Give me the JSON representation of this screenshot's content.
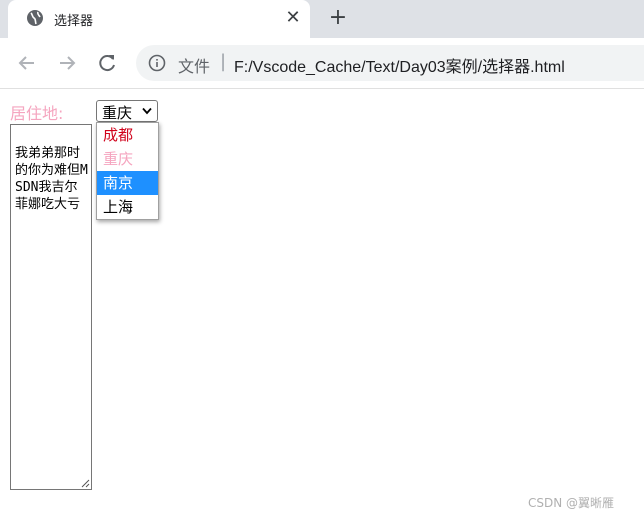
{
  "browser": {
    "tab": {
      "title": "选择器",
      "close_glyph": "✕"
    },
    "newtab_glyph": "+",
    "omnibox": {
      "scheme_label": "文件",
      "separator": "|",
      "url": "F:/Vscode_Cache/Text/Day03案例/选择器.html"
    },
    "icons": [
      "globe-icon",
      "back-arrow-icon",
      "forward-arrow-icon",
      "reload-icon",
      "info-icon",
      "close-icon",
      "plus-icon"
    ]
  },
  "form": {
    "label": "居住地:",
    "label_color": "#f5a5bf",
    "select": {
      "value": "重庆",
      "options": [
        {
          "label": "成都",
          "color": "#d0021b"
        },
        {
          "label": "重庆",
          "color": "#f5a5bf"
        },
        {
          "label": "南京",
          "color": "#ffffff",
          "highlight": "#1e90ff"
        },
        {
          "label": "上海",
          "color": "#000000"
        }
      ]
    },
    "textarea": {
      "value": "我弟弟那时的你为难但MSDN我吉尔菲娜吃大亏"
    }
  },
  "watermark": "CSDN @翼晰雁"
}
